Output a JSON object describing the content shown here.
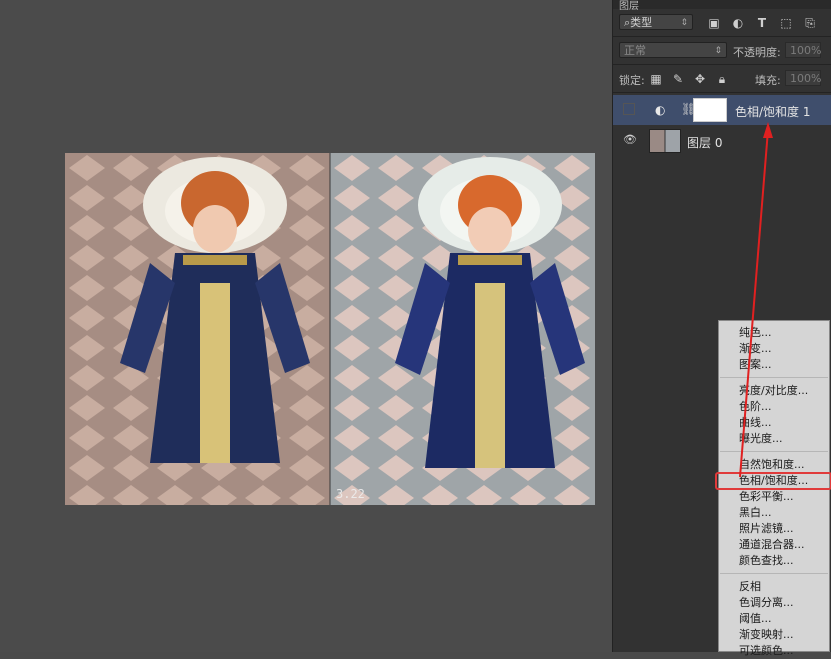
{
  "panel": {
    "tab_title": "图层",
    "filter_kind": "类型",
    "blend_mode": "正常",
    "opacity_label": "不透明度:",
    "opacity_value": "100%",
    "lock_label": "锁定:",
    "fill_label": "填充:",
    "fill_value": "100%"
  },
  "layers": [
    {
      "name": "色相/饱和度 1",
      "visible": false,
      "selected": true,
      "type": "adjustment"
    },
    {
      "name": "图层 0",
      "visible": true,
      "selected": false,
      "type": "pixel"
    }
  ],
  "artwork": {
    "date_stamp": "3.22"
  },
  "menu": {
    "groups": [
      [
        "纯色...",
        "渐变...",
        "图案..."
      ],
      [
        "亮度/对比度...",
        "色阶...",
        "曲线...",
        "曝光度..."
      ],
      [
        "自然饱和度...",
        "色相/饱和度...",
        "色彩平衡...",
        "黑白...",
        "照片滤镜...",
        "通道混合器...",
        "颜色查找..."
      ],
      [
        "反相",
        "色调分离...",
        "阈值...",
        "渐变映射...",
        "可选颜色..."
      ]
    ],
    "highlighted_item": "色相/饱和度...",
    "highlight_color": "#e03a3a"
  },
  "colors": {
    "selected_layer": "#3f4e6c",
    "panel_bg": "#323232",
    "canvas_bg": "#4b4b4b",
    "annotation_red": "#e02020"
  }
}
